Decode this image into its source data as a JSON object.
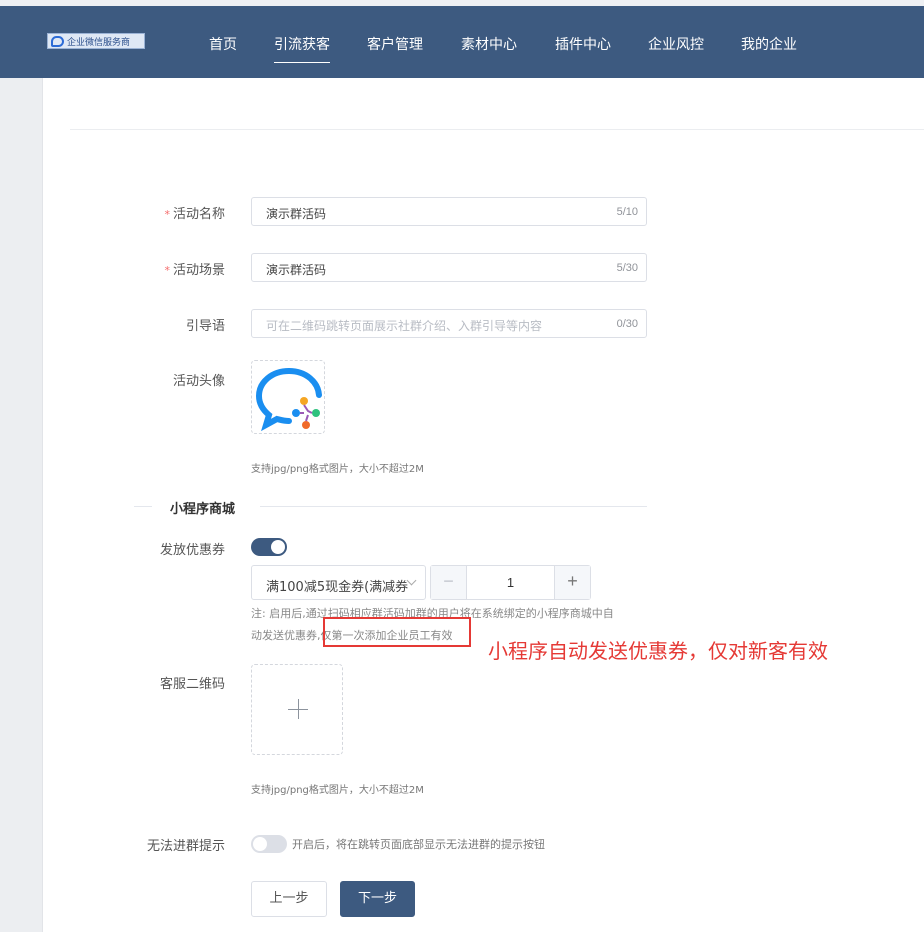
{
  "header": {
    "logo_text": "企业微信服务商",
    "nav": [
      {
        "label": "首页"
      },
      {
        "label": "引流获客",
        "active": true
      },
      {
        "label": "客户管理"
      },
      {
        "label": "素材中心"
      },
      {
        "label": "插件中心"
      },
      {
        "label": "企业风控"
      },
      {
        "label": "我的企业"
      }
    ]
  },
  "form": {
    "activity_name": {
      "label": "活动名称",
      "required_mark": "*",
      "value": "演示群活码",
      "count": "5/10"
    },
    "activity_scene": {
      "label": "活动场景",
      "required_mark": "*",
      "value": "演示群活码",
      "count": "5/30"
    },
    "guide_text": {
      "label": "引导语",
      "placeholder": "可在二维码跳转页面展示社群介绍、入群引导等内容",
      "count": "0/30"
    },
    "avatar": {
      "label": "活动头像",
      "hint": "支持jpg/png格式图片，大小不超过2M"
    },
    "section_title": "小程序商城",
    "coupon": {
      "label": "发放优惠券",
      "toggle_on": true,
      "selected": "满100减5现金券(满减券",
      "quantity": "1",
      "minus": "−",
      "plus": "+",
      "note_line1": "注: 启用后,通过扫码相应群活码加群的用户将在系统绑定的小程序商城中自",
      "note_line2": "动发送优惠券,仅第一次添加企业员工有效"
    },
    "service_qr": {
      "label": "客服二维码",
      "hint": "支持jpg/png格式图片，大小不超过2M"
    },
    "no_join_tip": {
      "label": "无法进群提示",
      "toggle_on": false,
      "text": "开启后，将在跳转页面底部显示无法进群的提示按钮"
    },
    "buttons": {
      "prev": "上一步",
      "next": "下一步"
    }
  },
  "annotation": {
    "text": "小程序自动发送优惠券，仅对新客有效",
    "color": "#e53935"
  },
  "colors": {
    "primary": "#3d5a80",
    "required": "#f56c6c"
  }
}
